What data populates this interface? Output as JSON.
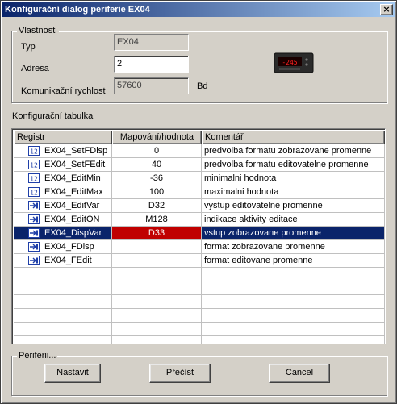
{
  "window": {
    "title": "Konfigurační dialog periferie EX04",
    "close_glyph": "×"
  },
  "properties": {
    "legend": "Vlastnosti",
    "type_label": "Typ",
    "type_value": "EX04",
    "address_label": "Adresa",
    "address_value": "2",
    "speed_label": "Komunikační rychlost",
    "speed_value": "57600",
    "speed_unit": "Bd"
  },
  "table": {
    "caption": "Konfigurační tabulka",
    "headers": [
      "Registr",
      "Mapování/hodnota",
      "Komentář"
    ],
    "rows": [
      {
        "icon": "number-register-icon",
        "name": "EX04_SetFDisp",
        "value": "0",
        "comment": "predvolba formatu zobrazovane promenne"
      },
      {
        "icon": "number-register-icon",
        "name": "EX04_SetFEdit",
        "value": "40",
        "comment": "predvolba formatu editovatelne promenne"
      },
      {
        "icon": "number-register-icon",
        "name": "EX04_EditMin",
        "value": "-36",
        "comment": "minimalni hodnota"
      },
      {
        "icon": "number-register-icon",
        "name": "EX04_EditMax",
        "value": "100",
        "comment": "maximalni hodnota"
      },
      {
        "icon": "mapped-register-icon",
        "name": "EX04_EditVar",
        "value": "D32",
        "comment": "vystup editovatelne promenne"
      },
      {
        "icon": "mapped-register-icon",
        "name": "EX04_EditON",
        "value": "M128",
        "comment": "indikace aktivity editace"
      },
      {
        "icon": "mapped-register-icon",
        "name": "EX04_DispVar",
        "value": "D33",
        "comment": "vstup zobrazovane promenne"
      },
      {
        "icon": "mapped-register-icon",
        "name": "EX04_FDisp",
        "value": "",
        "comment": "format zobrazovane promenne"
      },
      {
        "icon": "mapped-register-icon",
        "name": "EX04_FEdit",
        "value": "",
        "comment": "format editovane promenne"
      }
    ],
    "selected_index": 6
  },
  "periphery": {
    "legend": "Periferii...",
    "set_label": "Nastavit",
    "read_label": "Přečíst",
    "cancel_label": "Cancel"
  },
  "colors": {
    "selection": "#0a246a",
    "value_highlight": "#c00000"
  }
}
